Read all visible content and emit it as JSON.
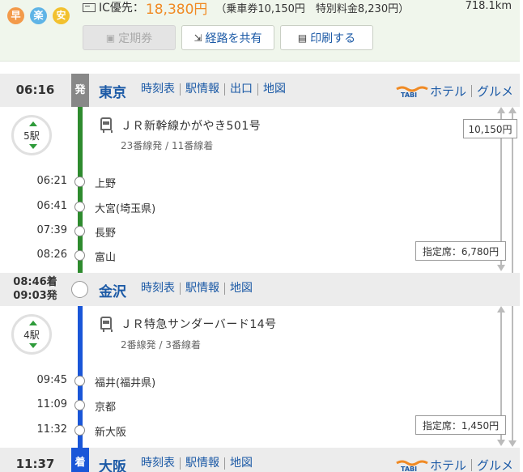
{
  "summary": {
    "badges": [
      {
        "label": "早",
        "color": "#f39a4a"
      },
      {
        "label": "楽",
        "color": "#5fb4e6"
      },
      {
        "label": "安",
        "color": "#f2c12e"
      }
    ],
    "ic_label": "IC優先：",
    "ic_fare": "18,380円",
    "ic_detail": "（乗車券10,150円　特別料金8,230円）",
    "distance": "718.1km"
  },
  "actions": {
    "commuter_pass": "定期券",
    "share_route": "経路を共有",
    "print": "印刷する"
  },
  "stations": {
    "tokyo": {
      "time": "06:16",
      "mark": "発",
      "name": "東京",
      "links": [
        "時刻表",
        "駅情報",
        "出口",
        "地図"
      ],
      "hotel": "ホテル",
      "gourmet": "グルメ"
    },
    "kanazawa": {
      "arrive": "08:46着",
      "depart": "09:03発",
      "name": "金沢",
      "links": [
        "時刻表",
        "駅情報",
        "地図"
      ]
    },
    "osaka": {
      "time": "11:37",
      "mark": "着",
      "name": "大阪",
      "links": [
        "時刻表",
        "駅情報",
        "地図"
      ],
      "hotel": "ホテル",
      "gourmet": "グルメ"
    }
  },
  "segments": [
    {
      "stop_count": "5駅",
      "train": "ＪＲ新幹線かがやき501号",
      "platform": "23番線発 / 11番線着",
      "line_color": "#2e8b2e",
      "fare": "10,150円",
      "seat_fare": "指定席：6,780円",
      "stops": [
        {
          "time": "06:21",
          "name": "上野"
        },
        {
          "time": "06:41",
          "name": "大宮(埼玉県)"
        },
        {
          "time": "07:39",
          "name": "長野"
        },
        {
          "time": "08:26",
          "name": "富山"
        }
      ]
    },
    {
      "stop_count": "4駅",
      "train": "ＪＲ特急サンダーバード14号",
      "platform": "2番線発 / 3番線着",
      "line_color": "#1a56d8",
      "seat_fare": "指定席：1,450円",
      "stops": [
        {
          "time": "09:45",
          "name": "福井(福井県)"
        },
        {
          "time": "11:09",
          "name": "京都"
        },
        {
          "time": "11:32",
          "name": "新大阪"
        }
      ]
    }
  ]
}
